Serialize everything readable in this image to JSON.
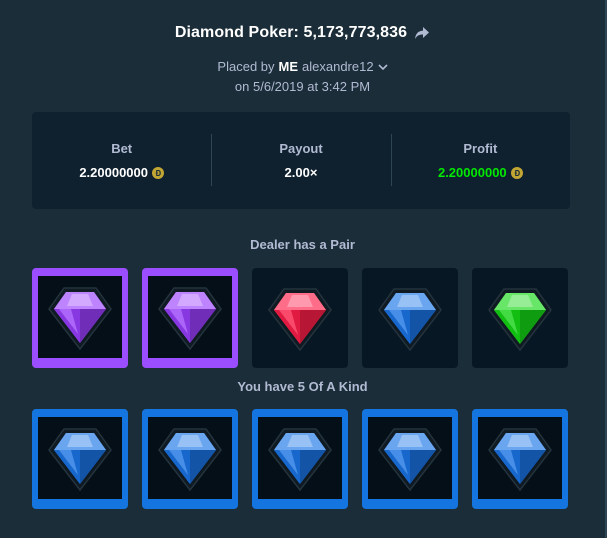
{
  "header": {
    "title": "Diamond Poker: 5,173,773,836",
    "placed_by": "Placed by",
    "me": "ME",
    "username": "alexandre12",
    "date": "on 5/6/2019 at 3:42 PM"
  },
  "stats": {
    "bet_label": "Bet",
    "bet_value": "2.20000000",
    "payout_label": "Payout",
    "payout_value": "2.00×",
    "profit_label": "Profit",
    "profit_value": "2.20000000"
  },
  "dealer": {
    "title": "Dealer has a Pair",
    "cards": [
      {
        "gem": "purple",
        "highlight": "purple"
      },
      {
        "gem": "purple",
        "highlight": "purple"
      },
      {
        "gem": "red",
        "highlight": "none"
      },
      {
        "gem": "blue",
        "highlight": "none"
      },
      {
        "gem": "green",
        "highlight": "none"
      }
    ]
  },
  "player": {
    "title": "You have 5 Of A Kind",
    "cards": [
      {
        "gem": "blue",
        "highlight": "blue"
      },
      {
        "gem": "blue",
        "highlight": "blue"
      },
      {
        "gem": "blue",
        "highlight": "blue"
      },
      {
        "gem": "blue",
        "highlight": "blue"
      },
      {
        "gem": "blue",
        "highlight": "blue"
      }
    ]
  },
  "colors": {
    "background": "#1b2d38",
    "panel": "#0f212e",
    "profit_green": "#00e701",
    "purple_highlight": "#9b4eff",
    "blue_highlight": "#1475e1",
    "gem_purple": "#9b40ff",
    "gem_red": "#ff1e4a",
    "gem_blue": "#1a75e8",
    "gem_green": "#16d816"
  },
  "icons": {
    "share": "share-arrow-icon",
    "chevron": "chevron-down-icon",
    "currency": "dogecoin-icon",
    "gem": "diamond-gem-icon"
  }
}
